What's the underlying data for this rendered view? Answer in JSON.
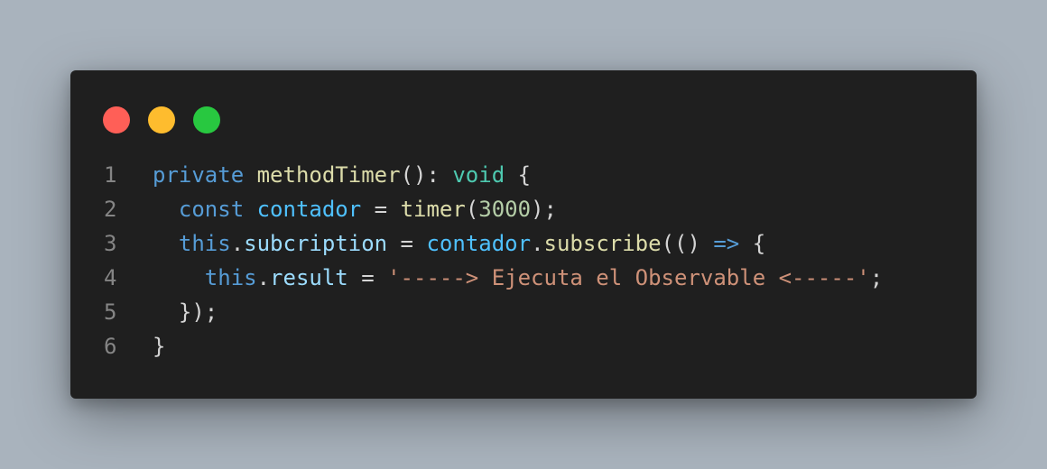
{
  "window": {
    "buttons": [
      "close",
      "minimize",
      "maximize"
    ]
  },
  "colors": {
    "background": "#a9b3bd",
    "editor": "#1f1f1f",
    "close": "#ff5f57",
    "minimize": "#febc2e",
    "maximize": "#28c840",
    "keyword": "#569cd6",
    "function": "#dcdcaa",
    "type": "#4ec9b0",
    "variable": "#4fc1ff",
    "property": "#9cdcfe",
    "number": "#b5cea8",
    "string": "#ce9178",
    "line_number": "#858585"
  },
  "code": {
    "lines": [
      {
        "number": "1",
        "tokens": [
          {
            "text": "private",
            "kind": "kw"
          },
          {
            "text": " ",
            "kind": "punc"
          },
          {
            "text": "methodTimer",
            "kind": "fn"
          },
          {
            "text": "(): ",
            "kind": "punc"
          },
          {
            "text": "void",
            "kind": "ty"
          },
          {
            "text": " {",
            "kind": "punc"
          }
        ]
      },
      {
        "number": "2",
        "tokens": [
          {
            "text": "  ",
            "kind": "punc"
          },
          {
            "text": "const",
            "kind": "kw"
          },
          {
            "text": " ",
            "kind": "punc"
          },
          {
            "text": "contador",
            "kind": "var"
          },
          {
            "text": " = ",
            "kind": "punc"
          },
          {
            "text": "timer",
            "kind": "fn"
          },
          {
            "text": "(",
            "kind": "punc"
          },
          {
            "text": "3000",
            "kind": "num"
          },
          {
            "text": ");",
            "kind": "punc"
          }
        ]
      },
      {
        "number": "3",
        "tokens": [
          {
            "text": "  ",
            "kind": "punc"
          },
          {
            "text": "this",
            "kind": "kw"
          },
          {
            "text": ".",
            "kind": "punc"
          },
          {
            "text": "subcription",
            "kind": "prop"
          },
          {
            "text": " = ",
            "kind": "punc"
          },
          {
            "text": "contador",
            "kind": "var"
          },
          {
            "text": ".",
            "kind": "punc"
          },
          {
            "text": "subscribe",
            "kind": "fn"
          },
          {
            "text": "(() ",
            "kind": "punc"
          },
          {
            "text": "=>",
            "kind": "kw"
          },
          {
            "text": " {",
            "kind": "punc"
          }
        ]
      },
      {
        "number": "4",
        "tokens": [
          {
            "text": "    ",
            "kind": "punc"
          },
          {
            "text": "this",
            "kind": "kw"
          },
          {
            "text": ".",
            "kind": "punc"
          },
          {
            "text": "result",
            "kind": "prop"
          },
          {
            "text": " = ",
            "kind": "punc"
          },
          {
            "text": "'-----> Ejecuta el Observable <-----'",
            "kind": "str"
          },
          {
            "text": ";",
            "kind": "punc"
          }
        ]
      },
      {
        "number": "5",
        "tokens": [
          {
            "text": "  });",
            "kind": "punc"
          }
        ]
      },
      {
        "number": "6",
        "tokens": [
          {
            "text": "}",
            "kind": "punc"
          }
        ]
      }
    ]
  }
}
